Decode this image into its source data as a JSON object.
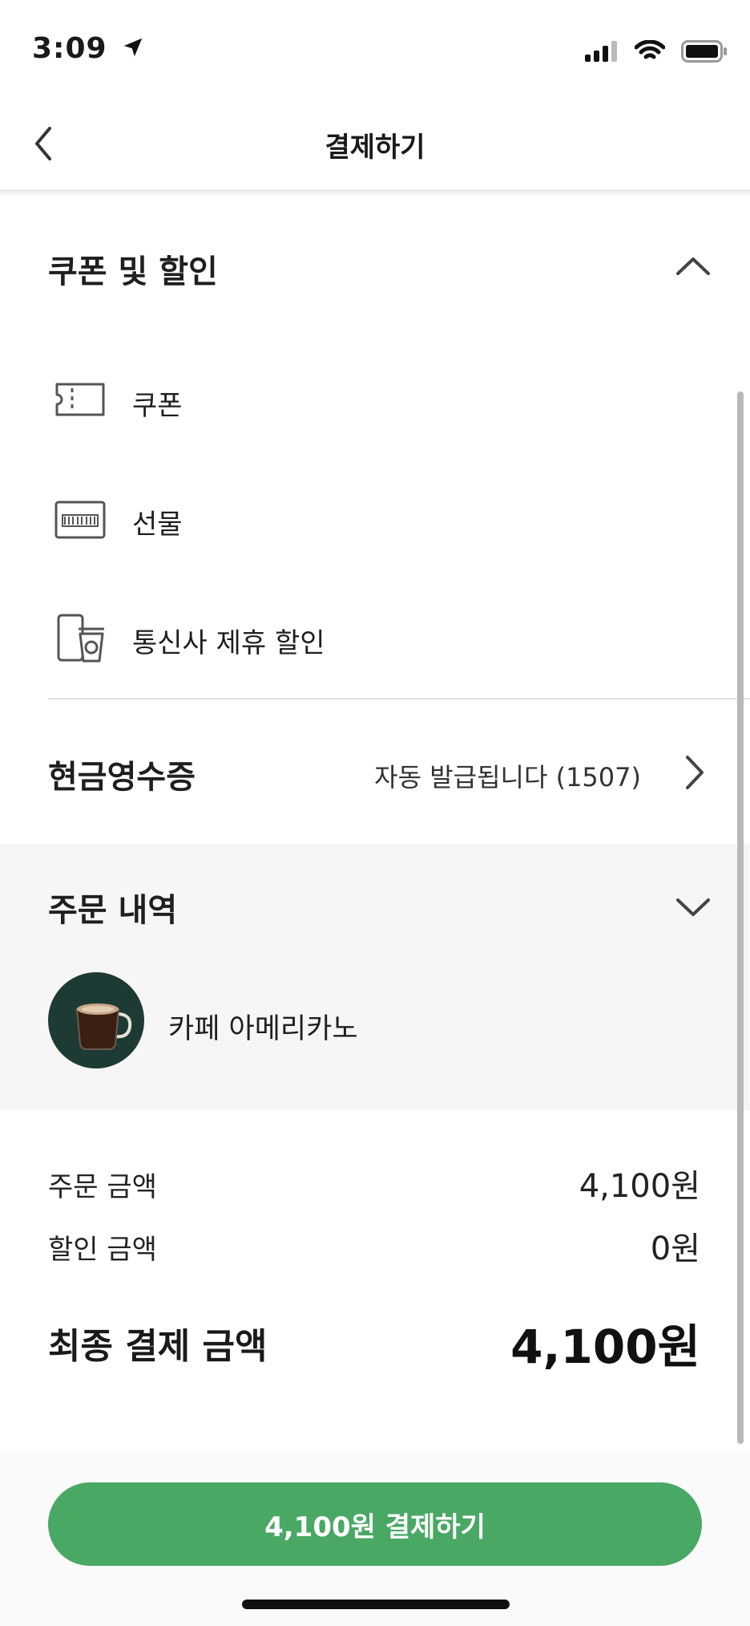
{
  "status_bar": {
    "time": "3:09"
  },
  "header": {
    "title": "결제하기"
  },
  "coupon_section": {
    "title": "쿠폰 및 할인",
    "items": [
      {
        "label": "쿠폰",
        "icon": "ticket-icon"
      },
      {
        "label": "선물",
        "icon": "gift-card-icon"
      },
      {
        "label": "통신사 제휴 할인",
        "icon": "phone-cup-icon"
      }
    ]
  },
  "receipt": {
    "title": "현금영수증",
    "value": "자동 발급됩니다 (1507)"
  },
  "order": {
    "title": "주문 내역",
    "items": [
      {
        "name": "카페 아메리카노",
        "icon": "coffee-mug-image"
      }
    ]
  },
  "summary": {
    "order_amount_label": "주문 금액",
    "order_amount": "4,100원",
    "discount_label": "할인 금액",
    "discount": "0원",
    "final_label": "최종 결제 금액",
    "final_amount": "4,100원"
  },
  "pay_button": {
    "label": "4,100원 결제하기"
  },
  "colors": {
    "accent": "#4aa865",
    "order_bg": "#f6f6f6",
    "avatar_bg": "#1d3b34"
  }
}
